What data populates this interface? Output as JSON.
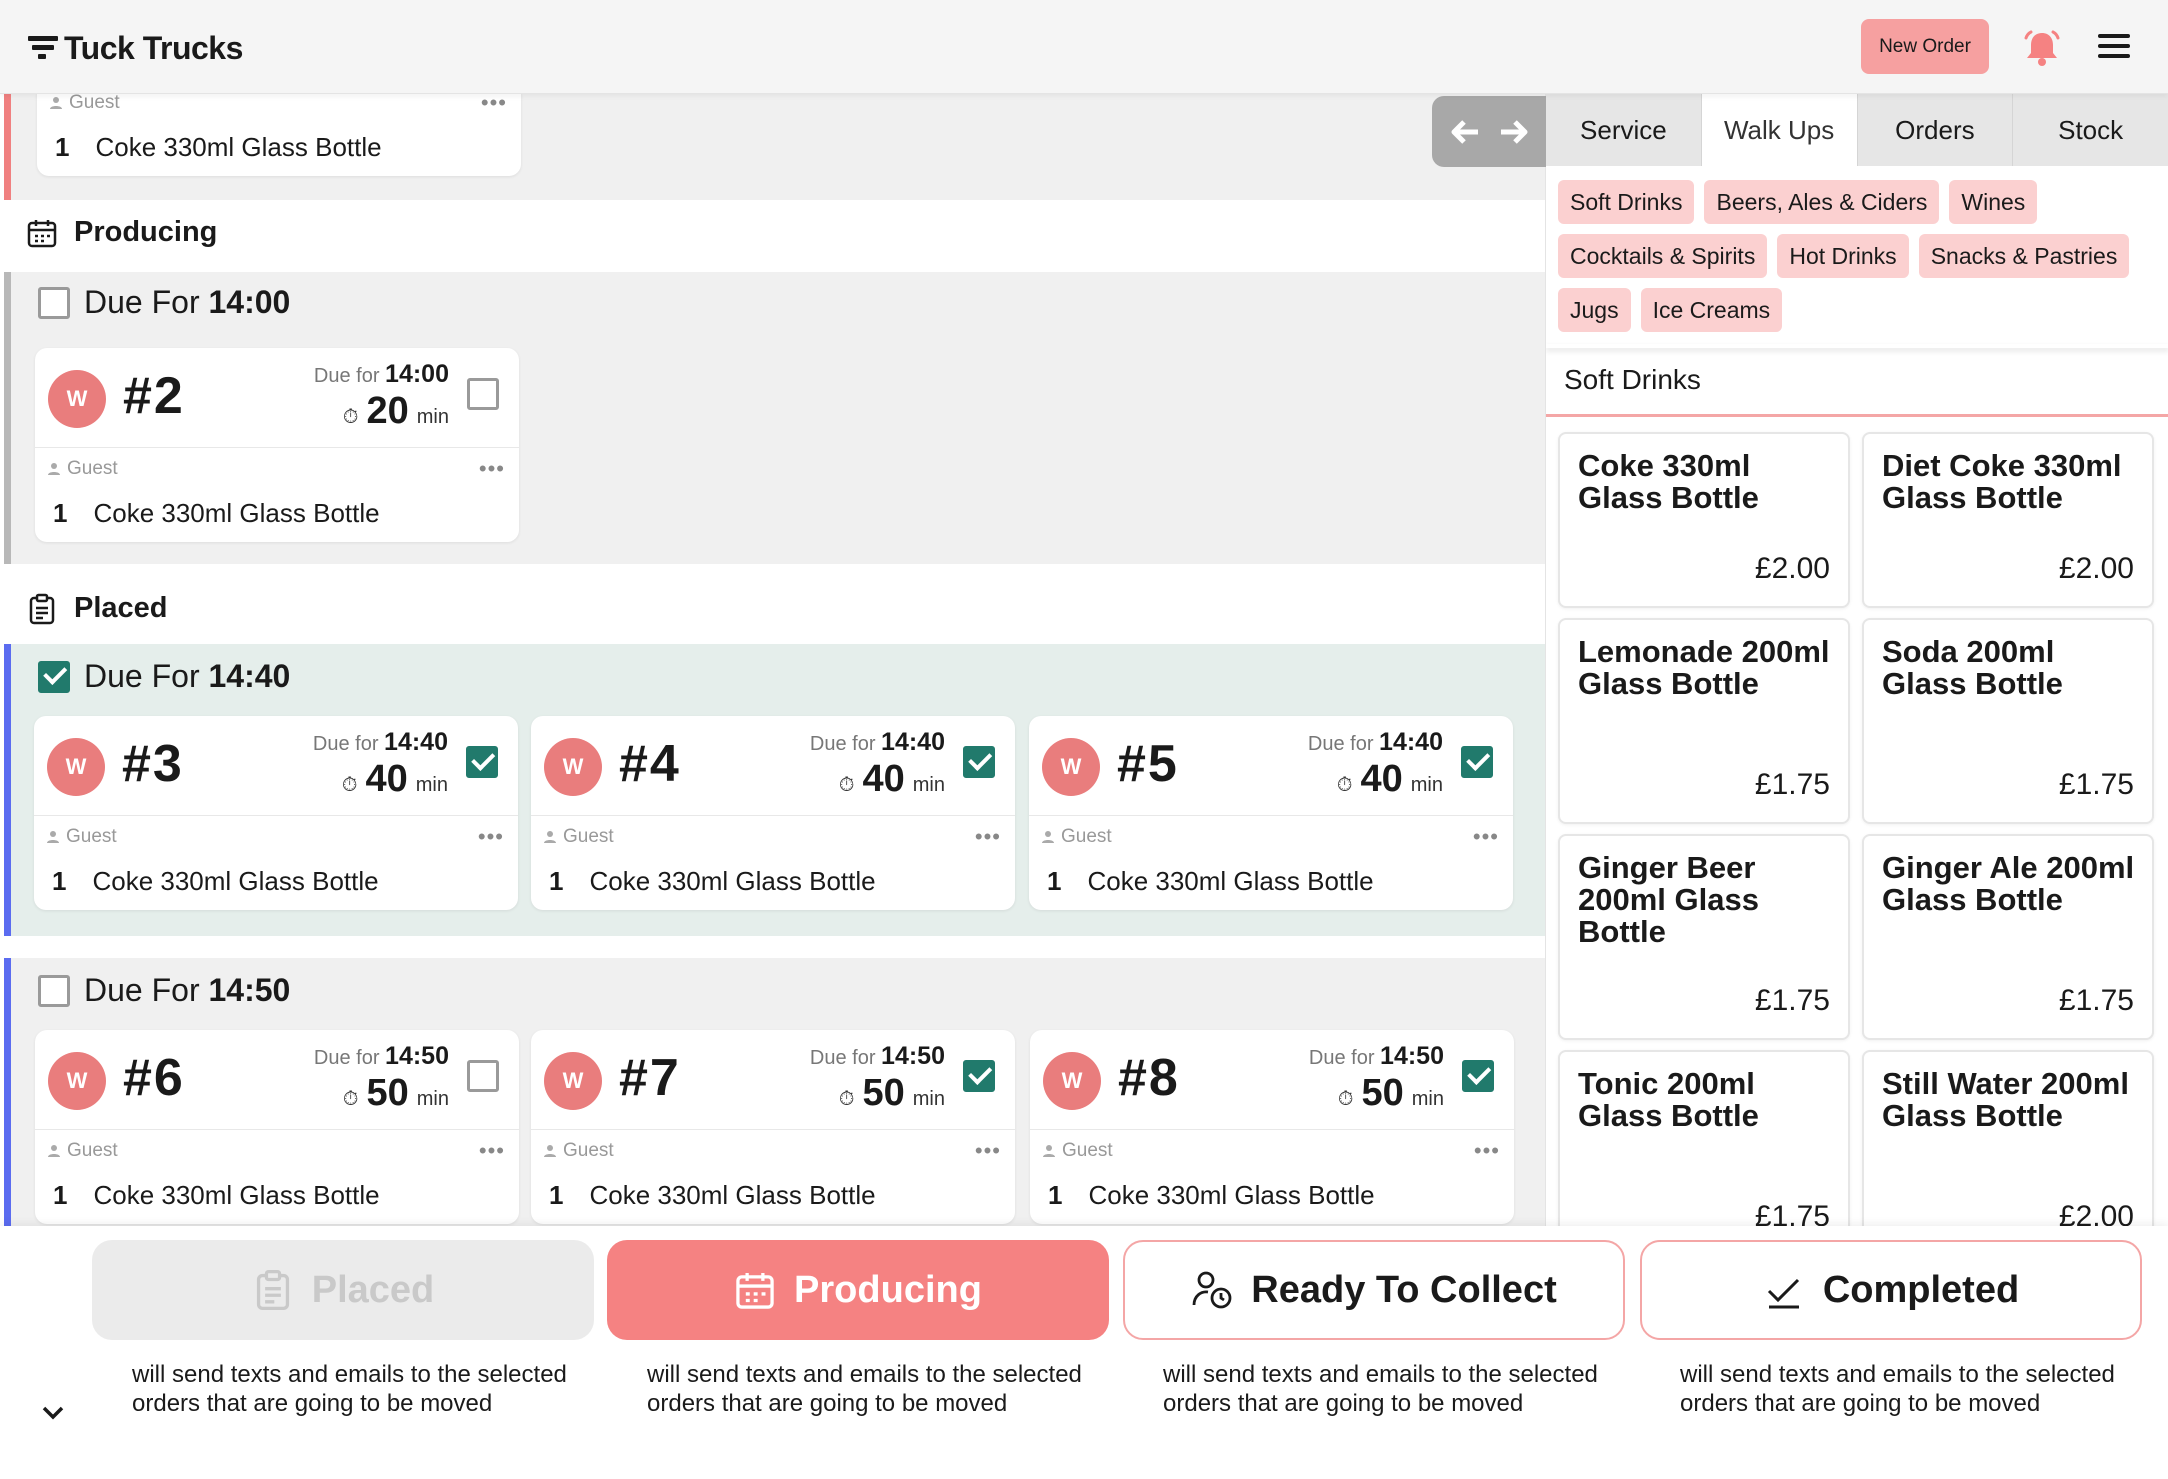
{
  "app": {
    "name": "Tuck Trucks",
    "new_order_label": "New Order"
  },
  "icons": {
    "logo": "truck-lines-icon",
    "bell": "bell-icon",
    "menu": "hamburger-menu-icon"
  },
  "colors": {
    "accent": "#f58282",
    "chip": "#fbd0d0",
    "checked": "#217a6c",
    "placed_lane": "#5b6cf0",
    "producing_lane": "#b8b8b8",
    "top_lane": "#f08080"
  },
  "board": {
    "top_card": {
      "customer": "Guest",
      "item": {
        "qty": "1",
        "name": "Coke 330ml Glass Bottle"
      }
    },
    "sections": {
      "producing": "Producing",
      "placed": "Placed"
    },
    "due_prefix": "Due For",
    "card_due_prefix": "Due for",
    "min_unit": "min",
    "groups": [
      {
        "time": "14:00",
        "checked": false,
        "orders": [
          {
            "avatar": "W",
            "number": "#2",
            "due": "14:00",
            "mins": "20",
            "checked": false,
            "customer": "Guest",
            "qty": "1",
            "item": "Coke 330ml Glass Bottle"
          }
        ]
      },
      {
        "time": "14:40",
        "checked": true,
        "orders": [
          {
            "avatar": "W",
            "number": "#3",
            "due": "14:40",
            "mins": "40",
            "checked": true,
            "customer": "Guest",
            "qty": "1",
            "item": "Coke 330ml Glass Bottle"
          },
          {
            "avatar": "W",
            "number": "#4",
            "due": "14:40",
            "mins": "40",
            "checked": true,
            "customer": "Guest",
            "qty": "1",
            "item": "Coke 330ml Glass Bottle"
          },
          {
            "avatar": "W",
            "number": "#5",
            "due": "14:40",
            "mins": "40",
            "checked": true,
            "customer": "Guest",
            "qty": "1",
            "item": "Coke 330ml Glass Bottle"
          }
        ]
      },
      {
        "time": "14:50",
        "checked": false,
        "orders": [
          {
            "avatar": "W",
            "number": "#6",
            "due": "14:50",
            "mins": "50",
            "checked": false,
            "customer": "Guest",
            "qty": "1",
            "item": "Coke 330ml Glass Bottle"
          },
          {
            "avatar": "W",
            "number": "#7",
            "due": "14:50",
            "mins": "50",
            "checked": true,
            "customer": "Guest",
            "qty": "1",
            "item": "Coke 330ml Glass Bottle"
          },
          {
            "avatar": "W",
            "number": "#8",
            "due": "14:50",
            "mins": "50",
            "checked": true,
            "customer": "Guest",
            "qty": "1",
            "item": "Coke 330ml Glass Bottle"
          }
        ]
      }
    ]
  },
  "panel": {
    "tabs": [
      "Service",
      "Walk Ups",
      "Orders",
      "Stock"
    ],
    "active_tab": "Walk Ups",
    "categories": [
      "Soft Drinks",
      "Beers, Ales & Ciders",
      "Wines",
      "Cocktails & Spirits",
      "Hot Drinks",
      "Snacks & Pastries",
      "Jugs",
      "Ice Creams"
    ],
    "section_title": "Soft Drinks",
    "products": [
      {
        "name": "Coke 330ml Glass Bottle",
        "price": "£2.00"
      },
      {
        "name": "Diet Coke 330ml Glass Bottle",
        "price": "£2.00"
      },
      {
        "name": "Lemonade 200ml Glass Bottle",
        "price": "£1.75"
      },
      {
        "name": "Soda 200ml Glass Bottle",
        "price": "£1.75"
      },
      {
        "name": "Ginger Beer 200ml Glass Bottle",
        "price": "£1.75"
      },
      {
        "name": "Ginger Ale 200ml Glass Bottle",
        "price": "£1.75"
      },
      {
        "name": "Tonic 200ml Glass Bottle",
        "price": "£1.75"
      },
      {
        "name": "Still Water 200ml Glass Bottle",
        "price": "£2.00"
      }
    ]
  },
  "actions": [
    {
      "label": "Placed",
      "icon": "clipboard-icon",
      "note": "will send texts and emails to the selected orders that are going to be moved"
    },
    {
      "label": "Producing",
      "icon": "calendar-icon",
      "note": "will send texts and emails to the selected orders that are going to be moved"
    },
    {
      "label": "Ready To Collect",
      "icon": "person-clock-icon",
      "note": "will send texts and emails to the selected orders that are going to be moved"
    },
    {
      "label": "Completed",
      "icon": "checkmark-icon",
      "note": "will send texts and emails to the selected orders that are going to be moved"
    }
  ]
}
